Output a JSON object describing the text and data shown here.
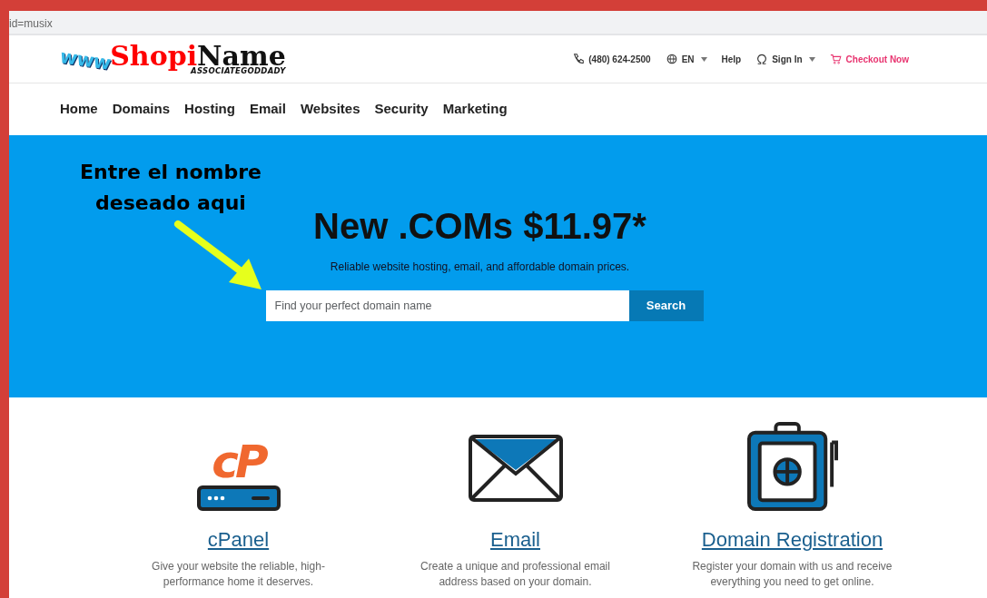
{
  "address_bar": {
    "url": "id=musix"
  },
  "logo": {
    "prefix": "www",
    "word1": "Shopi",
    "word2": "Name",
    "tagline": "ASSOCIATEGODDADY"
  },
  "utility_nav": [
    {
      "kind": "phone",
      "label": "(480) 624-2500",
      "dropdown": false
    },
    {
      "kind": "language",
      "label": "EN",
      "dropdown": true
    },
    {
      "kind": "plain",
      "label": "Help",
      "dropdown": false
    },
    {
      "kind": "account",
      "label": "Sign In",
      "dropdown": true
    },
    {
      "kind": "cart",
      "label": "Checkout Now",
      "dropdown": false
    }
  ],
  "main_nav": [
    "Home",
    "Domains",
    "Hosting",
    "Email",
    "Websites",
    "Security",
    "Marketing"
  ],
  "hero": {
    "annotation": "Entre el nombre deseado aqui",
    "title": "New .COMs $11.97*",
    "subtitle": "Reliable website hosting, email, and affordable domain prices.",
    "search": {
      "placeholder": "Find your perfect domain name",
      "button": "Search"
    }
  },
  "features": [
    {
      "kind": "cpanel",
      "logo_text": "cP",
      "title": "cPanel",
      "description": "Give your website the reliable, high-performance home it deserves."
    },
    {
      "kind": "email",
      "title": "Email",
      "description": "Create a unique and professional email address based on your domain."
    },
    {
      "kind": "domain",
      "title": "Domain Registration",
      "description": "Register your domain with us and receive everything you need to get online."
    }
  ]
}
